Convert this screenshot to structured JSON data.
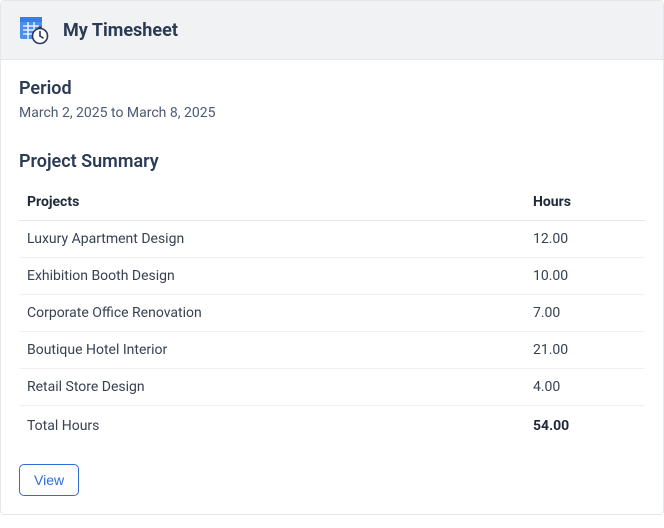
{
  "header": {
    "title": "My Timesheet"
  },
  "period": {
    "label": "Period",
    "text": "March 2, 2025 to March 8, 2025"
  },
  "summary": {
    "title": "Project Summary",
    "columns": {
      "project": "Projects",
      "hours": "Hours"
    },
    "rows": [
      {
        "project": "Luxury Apartment Design",
        "hours": "12.00"
      },
      {
        "project": "Exhibition Booth Design",
        "hours": "10.00"
      },
      {
        "project": "Corporate Office Renovation",
        "hours": "7.00"
      },
      {
        "project": "Boutique Hotel Interior",
        "hours": "21.00"
      },
      {
        "project": "Retail Store Design",
        "hours": "4.00"
      }
    ],
    "total": {
      "label": "Total Hours",
      "hours": "54.00"
    }
  },
  "actions": {
    "view_label": "View"
  }
}
